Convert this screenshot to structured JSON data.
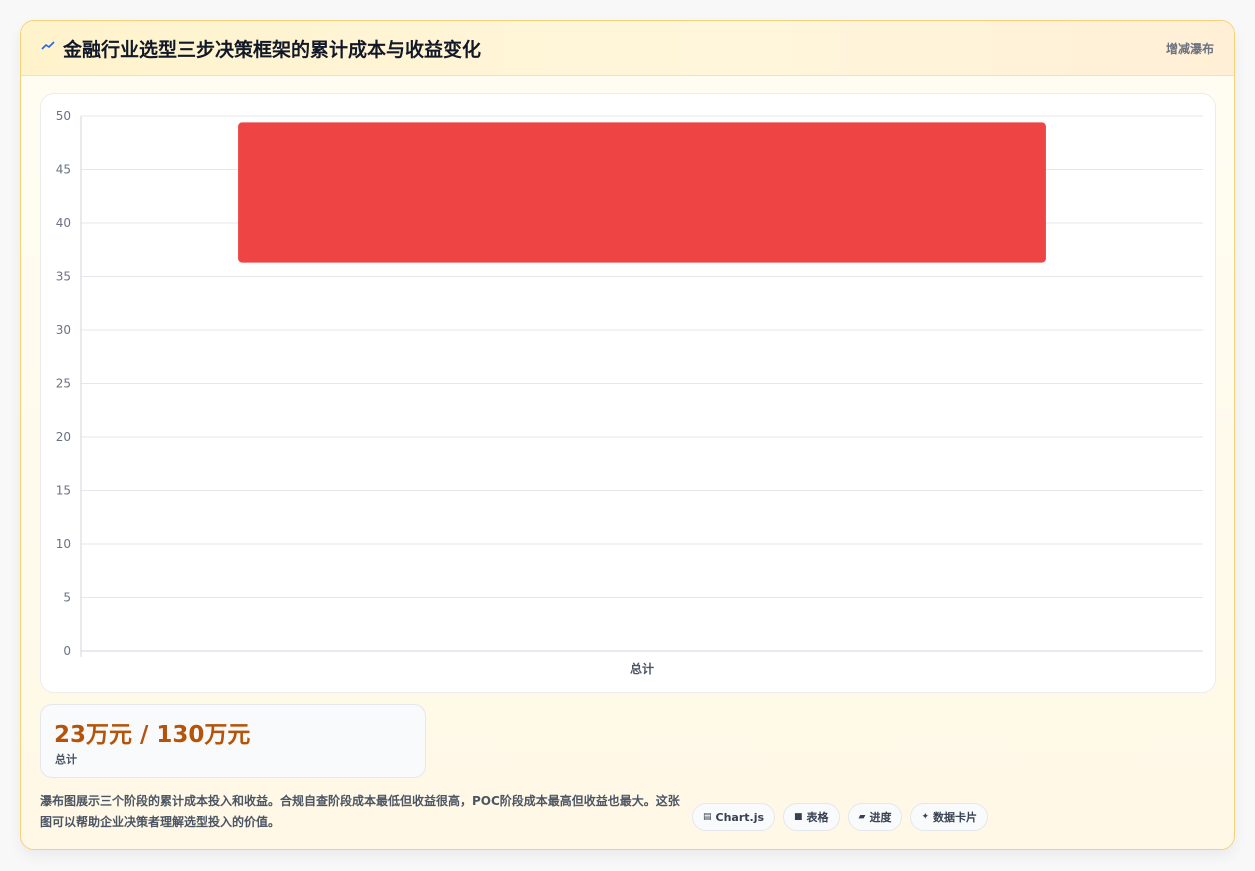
{
  "header": {
    "title": "金融行业选型三步决策框架的累计成本与收益变化",
    "chart_type_label": "增减瀑布",
    "title_icon": "line-chart-icon"
  },
  "stat": {
    "value": "23万元 / 130万元",
    "label": "总计"
  },
  "description": "瀑布图展示三个阶段的累计成本投入和收益。合规自查阶段成本最低但收益很高，POC阶段成本最高但收益也最大。这张图可以帮助企业决策者理解选型投入的价值。",
  "tags": [
    {
      "icon": "▤",
      "icon_name": "chart-icon",
      "label": "Chart.js"
    },
    {
      "icon": "■",
      "icon_name": "table-icon",
      "label": "表格"
    },
    {
      "icon": "▰",
      "icon_name": "progress-icon",
      "label": "进度"
    },
    {
      "icon": "✦",
      "icon_name": "sparkle-icon",
      "label": "数据卡片"
    }
  ],
  "colors": {
    "bar": "#ef4444",
    "accent": "#b45309",
    "border": "#f3d27a"
  },
  "chart_data": {
    "type": "bar",
    "subtype": "floating-bar",
    "categories": [
      "总计"
    ],
    "series": [
      {
        "values": [
          [
            36.3,
            49.4
          ]
        ],
        "color": "#ef4444"
      }
    ],
    "ylim": [
      0,
      50
    ],
    "yticks": [
      0,
      5,
      10,
      15,
      20,
      25,
      30,
      35,
      40,
      45,
      50
    ],
    "grid": true,
    "legend": "none",
    "title": "",
    "xlabel": "",
    "ylabel": ""
  }
}
